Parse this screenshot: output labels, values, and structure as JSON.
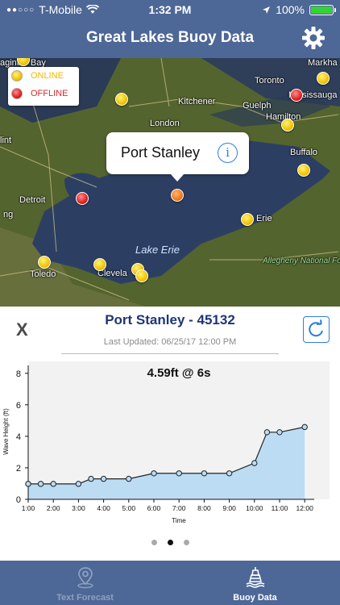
{
  "status_bar": {
    "carrier": "T-Mobile",
    "time": "1:32 PM",
    "battery": "100%",
    "battery_level": 1.0
  },
  "nav": {
    "title": "Great Lakes Buoy Data",
    "settings_icon": "gear-icon"
  },
  "map": {
    "cities": [
      {
        "name": "Markha"
      },
      {
        "name": "Toronto"
      },
      {
        "name": "Mississauga"
      },
      {
        "name": "Kitchener"
      },
      {
        "name": "Guelph"
      },
      {
        "name": "Hamilton"
      },
      {
        "name": "Buffalo"
      },
      {
        "name": "London"
      },
      {
        "name": "Detroit"
      },
      {
        "name": "Erie"
      },
      {
        "name": "Toledo"
      },
      {
        "name": "Clevela"
      },
      {
        "name": "Allegheny National Fo"
      },
      {
        "name": "aginaw Bay"
      },
      {
        "name": "lint"
      },
      {
        "name": "ng"
      }
    ],
    "lake_label": "Lake Erie",
    "legend": {
      "online": "ONLINE",
      "offline": "OFFLINE"
    },
    "callout": {
      "name": "Port Stanley",
      "info_icon": "i"
    }
  },
  "detail": {
    "close": "X",
    "station": "Port Stanley - 45132",
    "last_updated": "Last Updated: 06/25/17 12:00 PM"
  },
  "colors": {
    "nav_bar": "#4d6796",
    "title_text": "#1f3577",
    "accent": "#2f7fe0",
    "chart_fill": "#bcdcf4",
    "online": "#f2c400",
    "offline": "#e02121"
  },
  "chart_data": {
    "type": "area",
    "title": "4.59ft @ 6s",
    "xlabel": "Time",
    "ylabel": "Wave Height (ft)",
    "x": [
      "1:00",
      "1:30",
      "2:00",
      "3:00",
      "3:30",
      "4:00",
      "5:00",
      "6:00",
      "7:00",
      "8:00",
      "9:00",
      "10:00",
      "10:30",
      "11:00",
      "12:00"
    ],
    "x_ticks": [
      "1:00",
      "2:00",
      "3:00",
      "4:00",
      "5:00",
      "6:00",
      "7:00",
      "8:00",
      "9:00",
      "10:00",
      "11:00",
      "12:00"
    ],
    "y_ticks": [
      "0",
      "2",
      "4",
      "6",
      "8"
    ],
    "ylim": [
      0,
      8.5
    ],
    "series": [
      {
        "values": [
          0.98,
          0.98,
          0.98,
          0.98,
          1.3,
          1.3,
          1.3,
          1.65,
          1.65,
          1.65,
          1.65,
          2.3,
          4.26,
          4.26,
          4.59
        ]
      }
    ],
    "grid": false
  },
  "pager": {
    "pages": 3,
    "active": 1
  },
  "tabs": [
    {
      "label": "Text Forecast",
      "icon": "map-pin-icon",
      "active": false
    },
    {
      "label": "Buoy Data",
      "icon": "buoy-icon",
      "active": true
    }
  ]
}
